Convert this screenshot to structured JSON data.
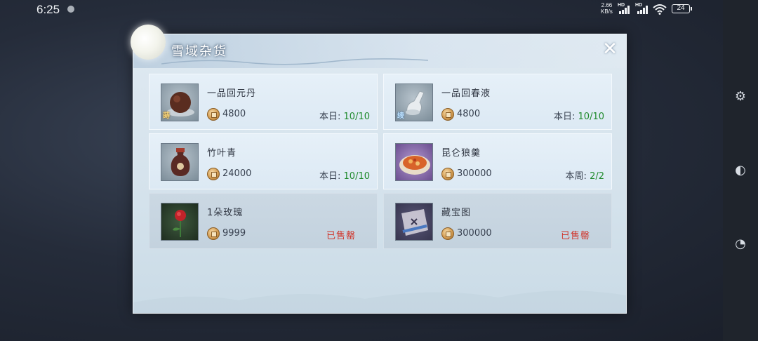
{
  "status_bar": {
    "time": "6:25",
    "net_speed_value": "2.66",
    "net_speed_unit": "KB/s",
    "hd_label_1": "HD",
    "hd_label_2": "HD",
    "battery": "24"
  },
  "panel": {
    "title": "雪域杂货",
    "close_label": "✕"
  },
  "items": [
    {
      "name": "一品回元丹",
      "price": "4800",
      "limit_label": "本日:",
      "limit_value": "10/10",
      "badge": "蒔"
    },
    {
      "name": "一品回春液",
      "price": "4800",
      "limit_label": "本日:",
      "limit_value": "10/10",
      "badge": "绫"
    },
    {
      "name": "竹叶青",
      "price": "24000",
      "limit_label": "本日:",
      "limit_value": "10/10"
    },
    {
      "name": "昆仑狼羹",
      "price": "300000",
      "limit_label": "本周:",
      "limit_value": "2/2"
    },
    {
      "name": "1朵玫瑰",
      "price": "9999",
      "sold_text": "已售罄"
    },
    {
      "name": "藏宝图",
      "price": "300000",
      "sold_text": "已售罄"
    }
  ],
  "colors": {
    "limit_value": "#1f8a2c",
    "sold_out": "#d0352b",
    "title_text": "#ffffff"
  }
}
